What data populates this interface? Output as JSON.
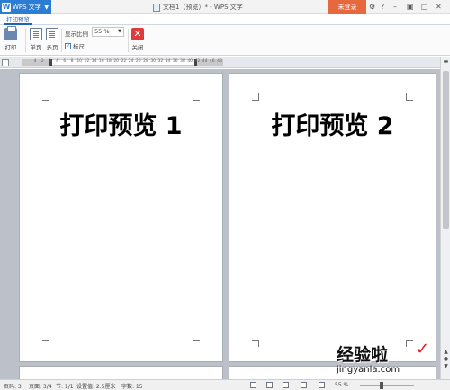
{
  "app": {
    "menu_label": "WPS 文字",
    "window_title": "文档1（预览）* - WPS 文字",
    "login_label": "未登录",
    "colors": {
      "accent": "#2b7cd3",
      "login": "#e8683e",
      "close": "#e03a3a"
    }
  },
  "ribbon": {
    "active_tab": "打印预览",
    "tools": {
      "print": "打印",
      "single_page": "单页",
      "multi_page": "多页",
      "close": "关闭"
    },
    "zoom_label": "显示比例",
    "zoom_value": "55 %",
    "ruler_label": "标尺",
    "ruler_checked": true
  },
  "ruler": {
    "numbers": [
      "4",
      "2",
      "2",
      "4",
      "6",
      "8",
      "10",
      "12",
      "14",
      "16",
      "18",
      "20",
      "22",
      "24",
      "26",
      "28",
      "30",
      "32",
      "34",
      "36",
      "38",
      "40",
      "42",
      "44",
      "46",
      "48"
    ]
  },
  "pages": [
    {
      "heading": "打印预览 1"
    },
    {
      "heading": "打印预览 2"
    }
  ],
  "watermark": {
    "text": "经验啦",
    "check": "✓",
    "url": "jingyanla.com"
  },
  "status": {
    "page": "页码: 3",
    "pages": "页面: 3/4",
    "section": "节: 1/1",
    "position": "设置值: 2.5厘米",
    "chars": "字数: 15",
    "zoom": "55 %"
  },
  "icons": [
    "print-icon",
    "single-page-icon",
    "multi-page-icon",
    "close-icon",
    "minimize-icon",
    "maximize-icon",
    "close-window-icon",
    "help-icon",
    "skin-icon"
  ]
}
